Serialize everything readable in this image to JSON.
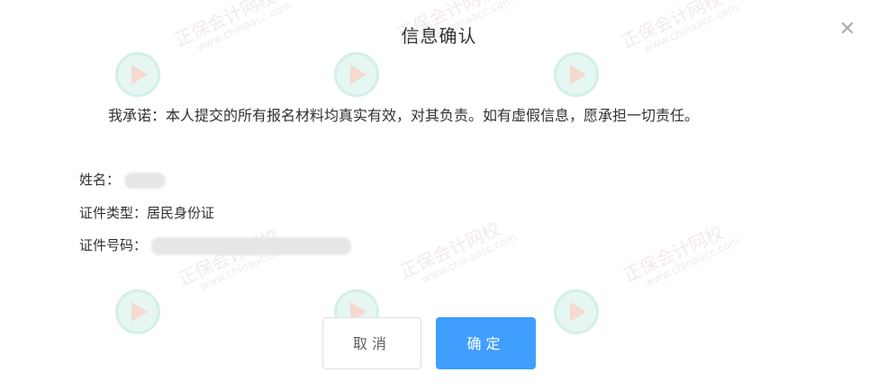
{
  "dialog": {
    "title": "信息确认",
    "close_icon": "close-icon",
    "statement": "我承诺：本人提交的所有报名材料均真实有效，对其负责。如有虚假信息，愿承担一切责任。",
    "fields": {
      "name_label": "姓名：",
      "id_type_label": "证件类型：",
      "id_type_value": "居民身份证",
      "id_number_label": "证件号码："
    },
    "buttons": {
      "cancel": "取消",
      "confirm": "确定"
    }
  },
  "watermark": {
    "brand": "正保会计网校",
    "url": "www.chinaacc.com"
  },
  "colors": {
    "primary": "#409eff",
    "text": "#303133",
    "border": "#dcdfe6"
  }
}
